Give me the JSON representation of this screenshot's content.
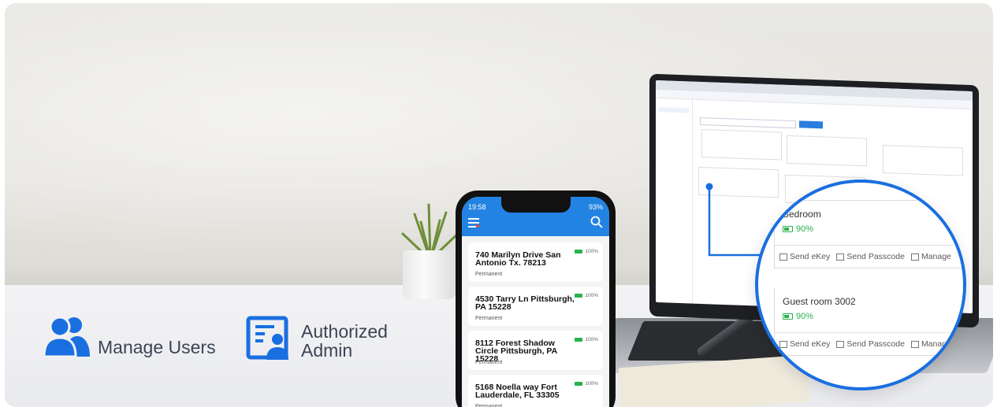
{
  "features": [
    {
      "icon": "users-icon",
      "label": "Manage Users"
    },
    {
      "icon": "admin-badge-icon",
      "label": "Authorized\nAdmin"
    }
  ],
  "zoom": {
    "rooms": [
      {
        "name": "Bedroom",
        "battery": "90%"
      },
      {
        "name": "Guest room  3002",
        "battery": "90%"
      }
    ],
    "actions": {
      "send_ekey": "Send eKey",
      "send_passcode": "Send Passcode",
      "manage": "Manage"
    }
  },
  "phone": {
    "time": "19:58",
    "signal": "93%",
    "properties": [
      {
        "address": "740 Marilyn Drive San Antonio Tx. 78213",
        "type": "Permanent",
        "battery": "100%"
      },
      {
        "address": "4530 Tarry Ln Pittsburgh, PA 15228",
        "type": "Permanent",
        "battery": "100%"
      },
      {
        "address": "8112 Forest Shadow Circle Pittsburgh, PA 15228",
        "type": "Permanent",
        "battery": "100%"
      },
      {
        "address": "5168 Noella way Fort Lauderdale, FL 33305",
        "type": "Permanent",
        "battery": "100%"
      }
    ]
  },
  "colors": {
    "accent": "#2383e2",
    "battery_green": "#28b24b",
    "label": "#3c4454"
  }
}
